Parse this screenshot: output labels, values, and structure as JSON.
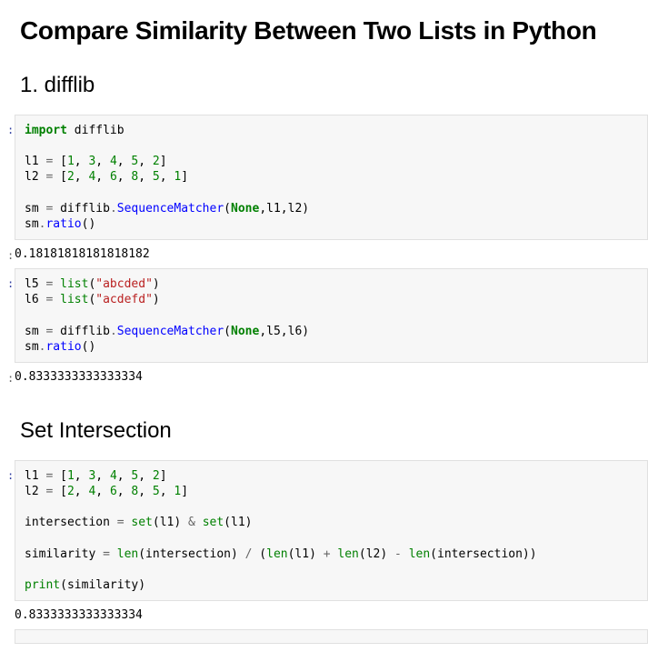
{
  "title": "Compare Similarity Between Two Lists in Python",
  "section1": "1. difflib",
  "section2": "Set Intersection",
  "prompts": {
    "in": ":",
    "out": ":"
  },
  "code1": {
    "line1_kw": "import",
    "line1_mod": " difflib",
    "l1_var": "l1 ",
    "eq": "=",
    "l1_open": " [",
    "l1_n1": "1",
    "c": ", ",
    "l1_n2": "3",
    "l1_n3": "4",
    "l1_n4": "5",
    "l1_n5": "2",
    "close": "]",
    "l2_var": "l2 ",
    "l2_n1": "2",
    "l2_n2": "4",
    "l2_n3": "6",
    "l2_n4": "8",
    "l2_n5": "5",
    "l2_n6": "1",
    "sm_var": "sm ",
    "difflib_dot": " difflib",
    "dot": ".",
    "seqm": "SequenceMatcher",
    "open_p": "(",
    "none": "None",
    "args12": ",l1,l2)",
    "sm_call": "sm",
    "ratio": "ratio",
    "call_p": "()"
  },
  "output1": "0.18181818181818182",
  "code2": {
    "l5_var": "l5 ",
    "list_fn": "list",
    "str1": "\"abcded\"",
    "l6_var": "l6 ",
    "str2": "\"acdefd\"",
    "args56": ",l5,l6)"
  },
  "output2": "0.8333333333333334",
  "code3": {
    "inter_var": "intersection ",
    "set_fn": "set",
    "l1_arg": "(l1) ",
    "amp": "&",
    "sp_set": " ",
    "l1_arg2": "(l1)",
    "sim_var": "similarity ",
    "len_fn": "len",
    "inter_arg": "(intersection) ",
    "slash": "/",
    "sp_open": " (",
    "l1_len": "(l1) ",
    "plus": "+",
    "sp": " ",
    "l2_len": "(l2) ",
    "minus": "-",
    "inter_arg2": "(intersection))",
    "print_fn": "print",
    "print_arg": "(similarity)"
  },
  "output3": "0.8333333333333334"
}
